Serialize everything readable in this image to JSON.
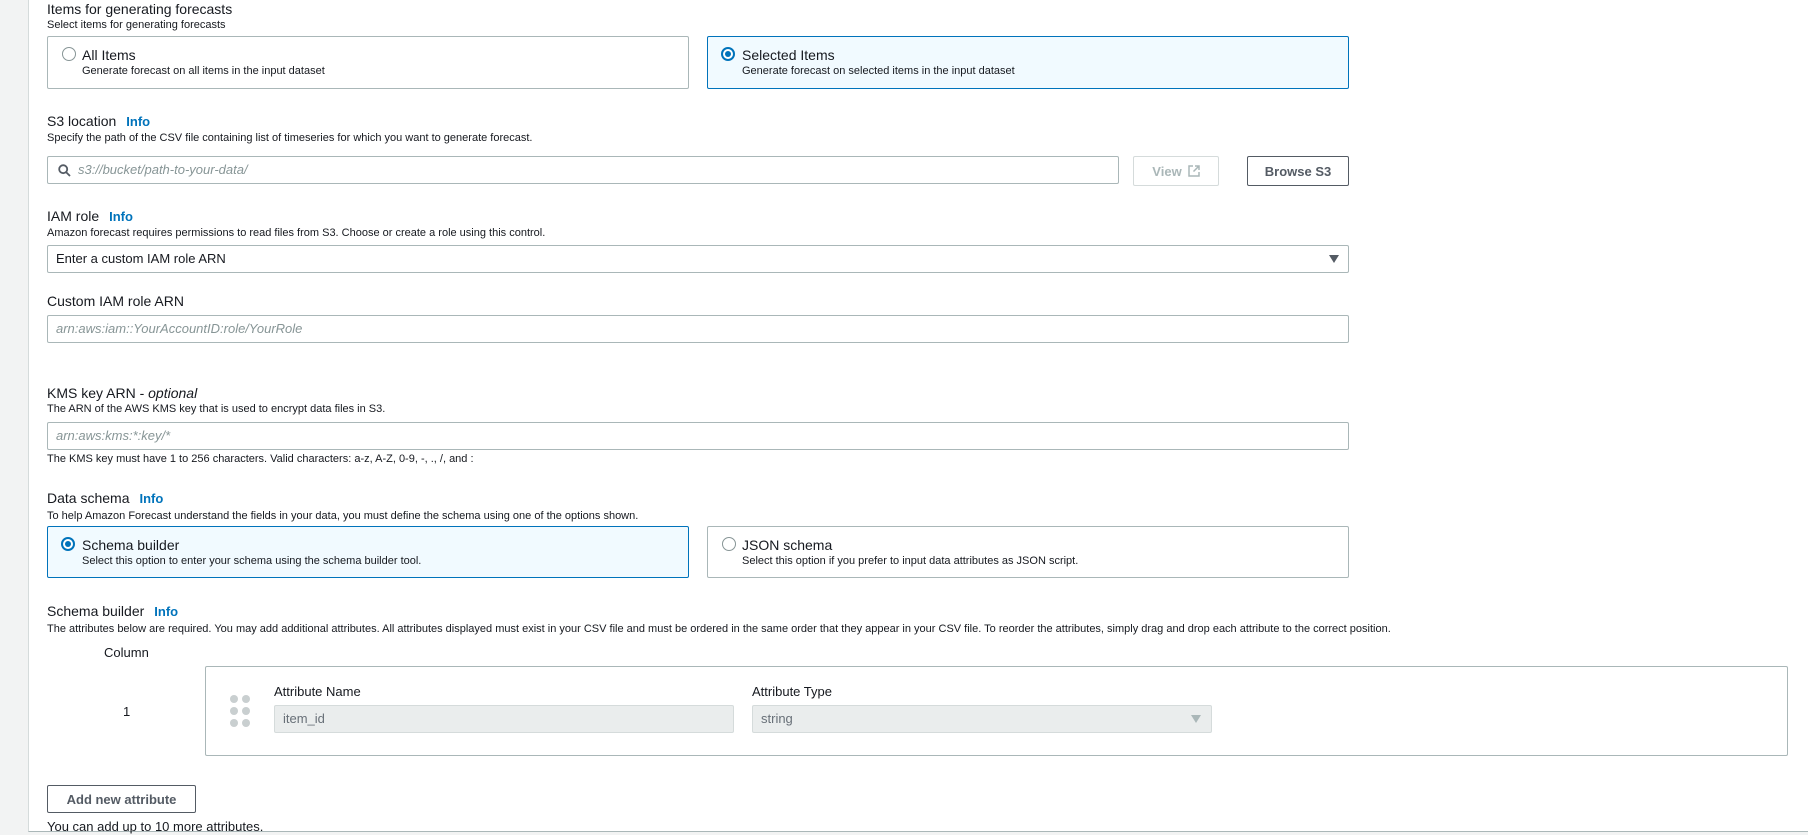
{
  "forecast_items": {
    "label": "Items for generating forecasts",
    "description": "Select items for generating forecasts",
    "options": [
      {
        "title": "All Items",
        "description": "Generate forecast on all items in the input dataset",
        "selected": false
      },
      {
        "title": "Selected Items",
        "description": "Generate forecast on selected items in the input dataset",
        "selected": true
      }
    ]
  },
  "s3": {
    "label": "S3 location",
    "info": "Info",
    "description": "Specify the path of the CSV file containing list of timeseries for which you want to generate forecast.",
    "placeholder": "s3://bucket/path-to-your-data/",
    "view_label": "View",
    "browse_label": "Browse S3"
  },
  "iam_role": {
    "label": "IAM role",
    "info": "Info",
    "description": "Amazon forecast requires permissions to read files from S3. Choose or create a role using this control.",
    "selected": "Enter a custom IAM role ARN"
  },
  "custom_iam": {
    "label": "Custom IAM role ARN",
    "placeholder": "arn:aws:iam::YourAccountID:role/YourRole"
  },
  "kms": {
    "label": "KMS key ARN - ",
    "optional": "optional",
    "description": "The ARN of the AWS KMS key that is used to encrypt data files in S3.",
    "placeholder": "arn:aws:kms:*:key/*",
    "constraint": "The KMS key must have 1 to 256 characters. Valid characters: a-z, A-Z, 0-9, -, ., /, and :"
  },
  "data_schema": {
    "label": "Data schema",
    "info": "Info",
    "description": "To help Amazon Forecast understand the fields in your data, you must define the schema using one of the options shown.",
    "options": [
      {
        "title": "Schema builder",
        "description": "Select this option to enter your schema using the schema builder tool.",
        "selected": true
      },
      {
        "title": "JSON schema",
        "description": "Select this option if you prefer to input data attributes as JSON script.",
        "selected": false
      }
    ]
  },
  "schema_builder": {
    "label": "Schema builder",
    "info": "Info",
    "description": "The attributes below are required. You may add additional attributes. All attributes displayed must exist in your CSV file and must be ordered in the same order that they appear in your CSV file. To reorder the attributes, simply drag and drop each attribute to the correct position.",
    "column_header": "Column",
    "rows": [
      {
        "column": "1",
        "name_label": "Attribute Name",
        "name_value": "item_id",
        "type_label": "Attribute Type",
        "type_value": "string"
      }
    ],
    "add_label": "Add new attribute",
    "limit_text": "You can add up to 10 more attributes."
  }
}
